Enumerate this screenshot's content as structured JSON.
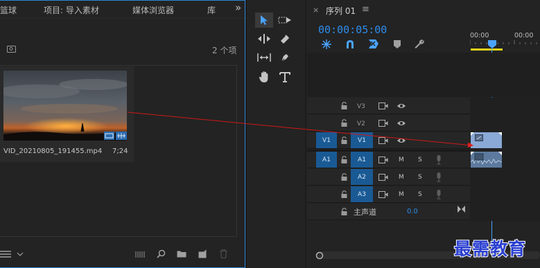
{
  "project_panel": {
    "tabs": [
      "篮球",
      "项目: 导入素材",
      "媒体浏览器",
      "库"
    ],
    "overflow": "»",
    "item_count": "2 个项",
    "clip": {
      "name": "VID_20210805_191455.mp4",
      "duration": "7;24"
    }
  },
  "timeline": {
    "sequence_tab": "序列 01",
    "close": "×",
    "menu": "≡",
    "timecode": "00:00:05:00",
    "ruler": [
      "00:00",
      "00:00"
    ],
    "tracks": {
      "video": [
        {
          "label": "V3"
        },
        {
          "label": "V2"
        },
        {
          "label": "V1",
          "source": "V1"
        }
      ],
      "audio": [
        {
          "label": "A1",
          "source": "A1",
          "mute": "M",
          "solo": "S"
        },
        {
          "label": "A2",
          "mute": "M",
          "solo": "S"
        },
        {
          "label": "A3",
          "mute": "M",
          "solo": "S"
        }
      ],
      "master": {
        "label": "主声道",
        "value": "0.0"
      }
    }
  },
  "watermark": "最需教育",
  "colors": {
    "accent_blue": "#2f86d8",
    "timecode_blue": "#2d8ceb",
    "track_blue": "#1a5a94",
    "clip_blue": "#8aa9d6",
    "playhead": "#4aa3ff"
  }
}
